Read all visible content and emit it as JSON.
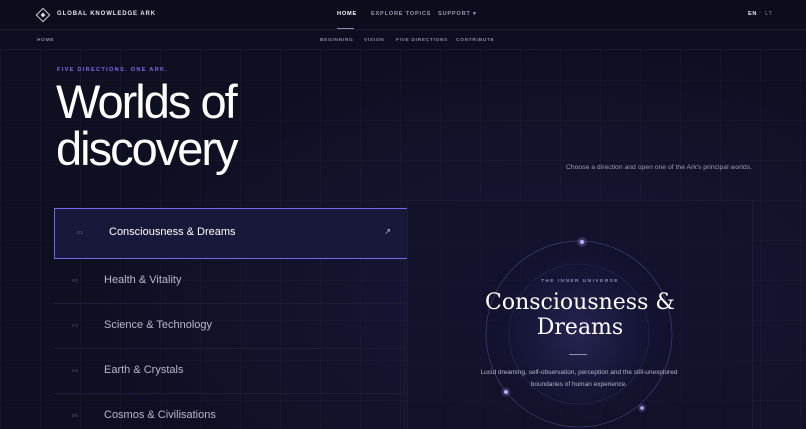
{
  "brand": {
    "name": "GLOBAL KNOWLEDGE ARK",
    "logo_icon": "diamond-logo-icon"
  },
  "topnav": {
    "links": [
      {
        "label": "HOME",
        "active": true
      },
      {
        "label": "EXPLORE TOPICS",
        "active": false
      },
      {
        "label": "SUPPORT ▾",
        "active": false
      }
    ],
    "languages": [
      {
        "label": "EN",
        "active": true
      },
      {
        "label": "/",
        "active": false
      },
      {
        "label": "LT",
        "active": false
      }
    ]
  },
  "subnav": {
    "breadcrumb": "HOME",
    "items": [
      "BEGINNING",
      "VISION",
      "FIVE DIRECTIONS",
      "CONTRIBUTE"
    ]
  },
  "hero": {
    "eyebrow": "FIVE DIRECTIONS. ONE ARK.",
    "title_line1": "Worlds of",
    "title_line2": "discovery",
    "subtitle": "Choose a direction and open one of the Ark's principal worlds."
  },
  "directions": [
    {
      "num": "01",
      "label": "Consciousness & Dreams",
      "active": true,
      "arrow": "↗"
    },
    {
      "num": "02",
      "label": "Health & Vitality",
      "active": false
    },
    {
      "num": "03",
      "label": "Science & Technology",
      "active": false
    },
    {
      "num": "04",
      "label": "Earth & Crystals",
      "active": false
    },
    {
      "num": "05",
      "label": "Cosmos & Civilisations",
      "active": false
    }
  ],
  "feature": {
    "eyebrow": "THE INNER UNIVERSE",
    "title_line1": "Consciousness &",
    "title_line2": "Dreams",
    "description": "Lucid dreaming, self-observation, perception and the still-unexplored boundaries of human experience."
  },
  "colors": {
    "accent": "#7566e6",
    "eyebrow": "#7d6df0",
    "background": "#0f0f22",
    "orbit_dot": "#b9a8ff"
  }
}
